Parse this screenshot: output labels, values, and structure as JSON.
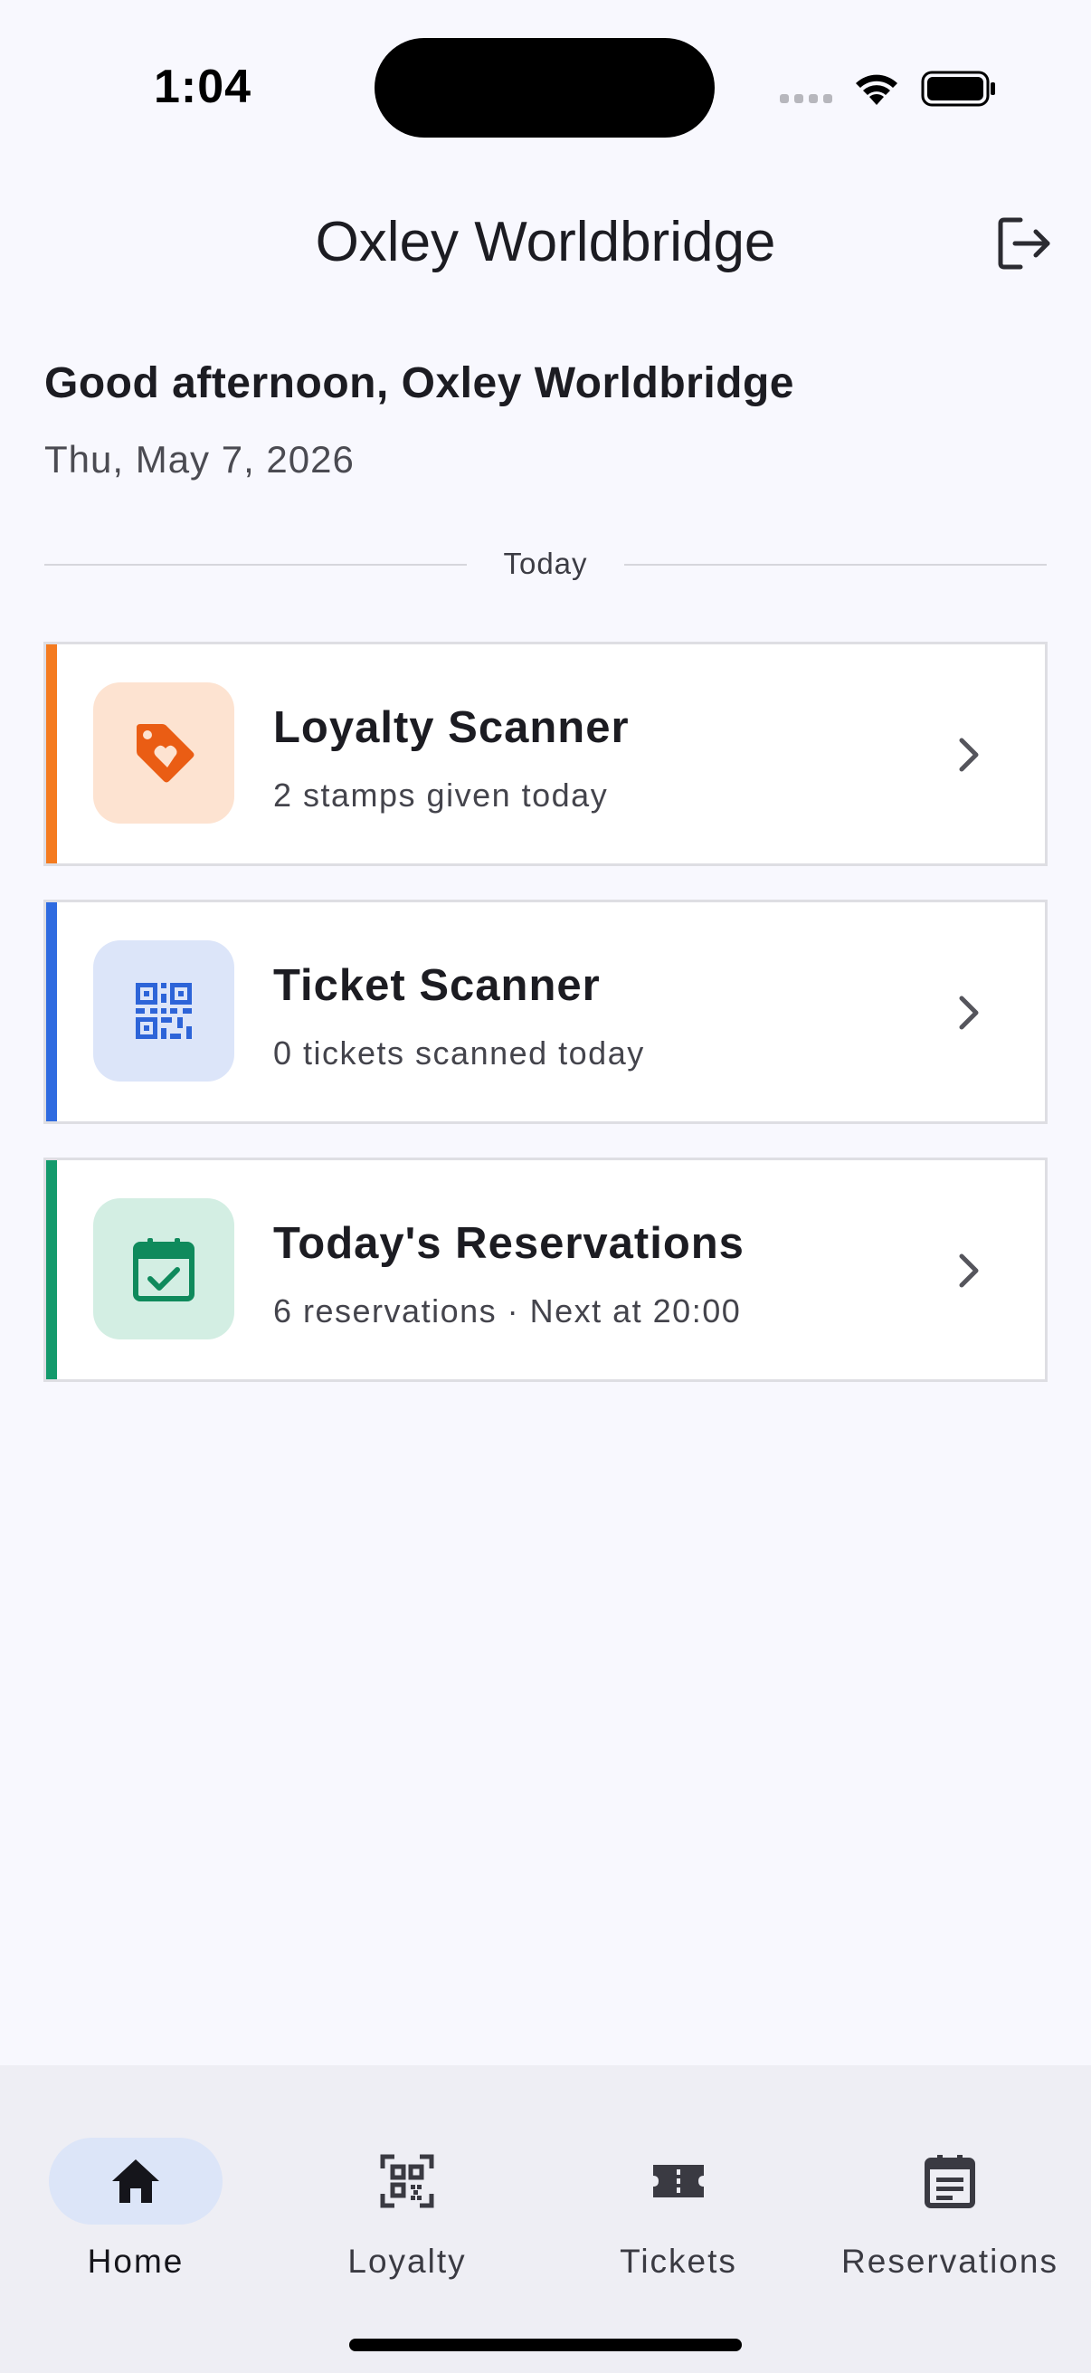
{
  "status_bar": {
    "time": "1:04"
  },
  "header": {
    "title": "Oxley Worldbridge"
  },
  "greeting": {
    "text": "Good afternoon, Oxley Worldbridge",
    "date": "Thu, May 7, 2026"
  },
  "section": {
    "label": "Today"
  },
  "cards": [
    {
      "title": "Loyalty Scanner",
      "subtitle": "2 stamps given today",
      "icon": "tag-heart-icon",
      "accent": "#f47b20",
      "tile_bg": "#fde3d1",
      "icon_color": "#ea5d14"
    },
    {
      "title": "Ticket Scanner",
      "subtitle": "0 tickets scanned today",
      "icon": "qr-code-icon",
      "accent": "#2f6be0",
      "tile_bg": "#dce5f9",
      "icon_color": "#2d64d8"
    },
    {
      "title": "Today's Reservations",
      "subtitle": "6 reservations · Next at 20:00",
      "icon": "calendar-check-icon",
      "accent": "#149a6c",
      "tile_bg": "#d3eee3",
      "icon_color": "#0f8a5c"
    }
  ],
  "nav": {
    "items": [
      {
        "label": "Home",
        "icon": "home-icon",
        "active": true
      },
      {
        "label": "Loyalty",
        "icon": "qr-scan-icon",
        "active": false
      },
      {
        "label": "Tickets",
        "icon": "ticket-icon",
        "active": false
      },
      {
        "label": "Reservations",
        "icon": "reservations-icon",
        "active": false
      }
    ]
  }
}
